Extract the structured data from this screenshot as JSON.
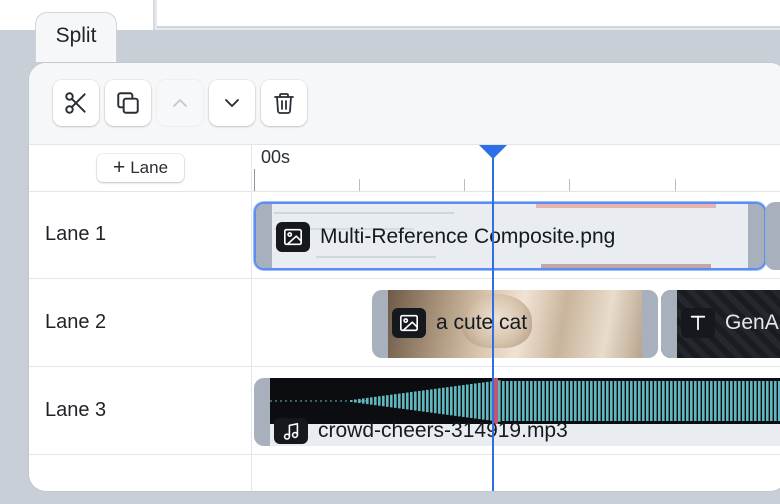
{
  "tab": {
    "label": "Split"
  },
  "toolbar": {
    "buttons": [
      {
        "name": "cut",
        "icon": "scissors-icon",
        "enabled": true
      },
      {
        "name": "duplicate",
        "icon": "copy-icon",
        "enabled": true
      },
      {
        "name": "move-up",
        "icon": "chevron-up-icon",
        "enabled": false
      },
      {
        "name": "move-down",
        "icon": "chevron-down-icon",
        "enabled": true
      },
      {
        "name": "delete",
        "icon": "trash-icon",
        "enabled": true
      }
    ]
  },
  "timeline": {
    "add_lane_label": "Lane",
    "ruler_start": "00s",
    "lanes": [
      {
        "label": "Lane 1"
      },
      {
        "label": "Lane 2"
      },
      {
        "label": "Lane 3"
      }
    ],
    "clips": [
      {
        "lane": 1,
        "name": "Multi-Reference Composite.png",
        "kind": "image",
        "selected": true
      },
      {
        "lane": 2,
        "name": "a cute cat",
        "kind": "image",
        "selected": false
      },
      {
        "lane": 2,
        "name": "GenA",
        "kind": "text",
        "selected": false
      },
      {
        "lane": 3,
        "name": "crowd-cheers-314919.mp3",
        "kind": "audio",
        "selected": false
      }
    ]
  },
  "colors": {
    "accent": "#2f6fe6",
    "waveform": "#5fb8c0",
    "audio_bg": "#0c0d10"
  }
}
